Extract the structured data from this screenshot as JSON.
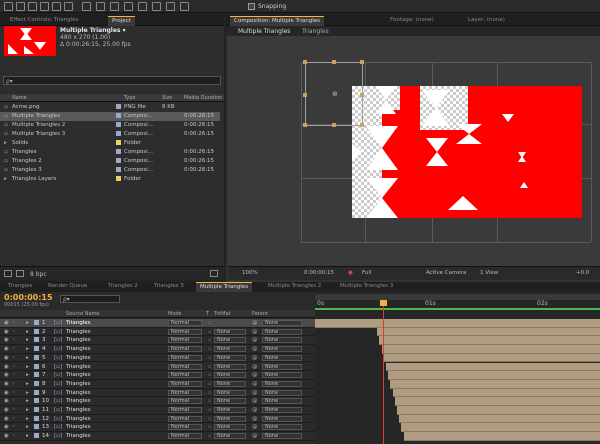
{
  "toolbar": {
    "snapping_label": "Snapping"
  },
  "project_panel": {
    "tabs": [
      "Effect Controls: Triangles",
      "Project"
    ],
    "comp_name": "Multiple Triangles ▾",
    "comp_size": "480 x 270 (1.00)",
    "comp_duration": "Δ 0:00:26:15, 25.00 fps",
    "search_placeholder": "ρ▾",
    "columns": {
      "name": "Name",
      "type": "Type",
      "size": "Size",
      "duration": "Media Duration"
    },
    "items": [
      {
        "name": "Acme.png",
        "type": "PNG file",
        "size": "8 KB",
        "duration": "",
        "color": "#9aa9c9"
      },
      {
        "name": "Multiple Triangles",
        "type": "Composi...",
        "size": "",
        "duration": "0:00:26:15",
        "color": "#9aa9c9"
      },
      {
        "name": "Multiple Triangles 2",
        "type": "Composi...",
        "size": "",
        "duration": "0:00:26:15",
        "color": "#9aa9c9"
      },
      {
        "name": "Multiple Triangles 3",
        "type": "Composi...",
        "size": "",
        "duration": "0:00:26:15",
        "color": "#9aa9c9"
      },
      {
        "name": "Solids",
        "type": "Folder",
        "size": "",
        "duration": "",
        "color": "#e5d26a"
      },
      {
        "name": "Triangles",
        "type": "Composi...",
        "size": "",
        "duration": "0:00:26:15",
        "color": "#9aa9c9"
      },
      {
        "name": "Triangles 2",
        "type": "Composi...",
        "size": "",
        "duration": "0:00:26:15",
        "color": "#9aa9c9"
      },
      {
        "name": "Triangles 3",
        "type": "Composi...",
        "size": "",
        "duration": "0:00:26:15",
        "color": "#9aa9c9"
      },
      {
        "name": "Triangles Layers",
        "type": "Folder",
        "size": "",
        "duration": "",
        "color": "#e5d26a"
      }
    ],
    "bpc": "8 bpc"
  },
  "composition_panel": {
    "tabs": [
      "Composition: Multiple Triangles",
      "Footage: (none)",
      "Layer: (none)"
    ],
    "breadcrumb": [
      "Multiple Triangles",
      "Triangles"
    ],
    "zoom": "100%",
    "timecode": "0:00:00:15",
    "resolution": "Full",
    "camera": "Active Camera",
    "views": "1 View",
    "exposure": "+0.0"
  },
  "timeline": {
    "tabs": [
      "Triangles",
      "Render Queue",
      "Triangles 2",
      "Triangles 3",
      "Multiple Triangles",
      "Multiple Triangles 2",
      "Multiple Triangles 3"
    ],
    "current_time": "0:00:00:15",
    "frame_info": "00015 (25.00 fps)",
    "search_placeholder": "ρ▾",
    "columns": {
      "name": "Source Name",
      "mode": "Mode",
      "t": "T",
      "trkmat": "TrkMat",
      "parent": "Parent"
    },
    "ruler": [
      "0s",
      "01s",
      "02s"
    ],
    "layers": [
      {
        "num": "1",
        "name": "Triangles",
        "mode": "Normal",
        "trkmat": "",
        "parent": "None"
      },
      {
        "num": "2",
        "name": "Triangles",
        "mode": "Normal",
        "trkmat": "None",
        "parent": "None"
      },
      {
        "num": "3",
        "name": "Triangles",
        "mode": "Normal",
        "trkmat": "None",
        "parent": "None"
      },
      {
        "num": "4",
        "name": "Triangles",
        "mode": "Normal",
        "trkmat": "None",
        "parent": "None"
      },
      {
        "num": "5",
        "name": "Triangles",
        "mode": "Normal",
        "trkmat": "None",
        "parent": "None"
      },
      {
        "num": "6",
        "name": "Triangles",
        "mode": "Normal",
        "trkmat": "None",
        "parent": "None"
      },
      {
        "num": "7",
        "name": "Triangles",
        "mode": "Normal",
        "trkmat": "None",
        "parent": "None"
      },
      {
        "num": "8",
        "name": "Triangles",
        "mode": "Normal",
        "trkmat": "None",
        "parent": "None"
      },
      {
        "num": "9",
        "name": "Triangles",
        "mode": "Normal",
        "trkmat": "None",
        "parent": "None"
      },
      {
        "num": "10",
        "name": "Triangles",
        "mode": "Normal",
        "trkmat": "None",
        "parent": "None"
      },
      {
        "num": "11",
        "name": "Triangles",
        "mode": "Normal",
        "trkmat": "None",
        "parent": "None"
      },
      {
        "num": "12",
        "name": "Triangles",
        "mode": "Normal",
        "trkmat": "None",
        "parent": "None"
      },
      {
        "num": "13",
        "name": "Triangles",
        "mode": "Normal",
        "trkmat": "None",
        "parent": "None"
      },
      {
        "num": "14",
        "name": "Triangles",
        "mode": "Normal",
        "trkmat": "None",
        "parent": "None"
      }
    ]
  },
  "colors": {
    "accent": "#ffb13d",
    "layer_bar": "#b09c80",
    "comp_bg": "#ff0000"
  }
}
